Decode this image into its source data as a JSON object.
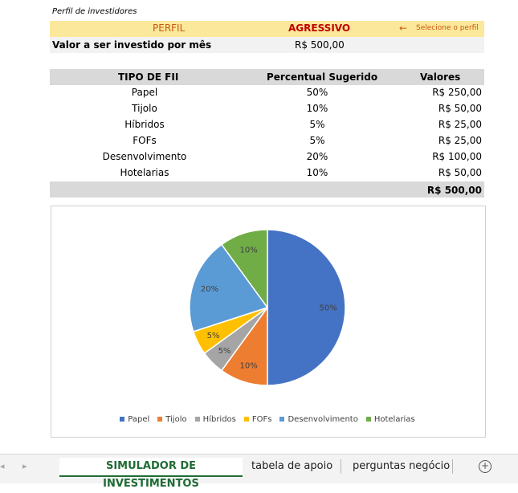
{
  "caption": "Perfil de investidores",
  "perfil": {
    "label": "PERFIL",
    "value": "AGRESSIVO",
    "hint_arrow": "←",
    "hint": "Selecione o perfil"
  },
  "valor": {
    "label": "Valor a ser investido por mês",
    "value": "R$ 500,00"
  },
  "table": {
    "headers": [
      "TIPO DE FII",
      "Percentual Sugerido",
      "Valores"
    ],
    "rows": [
      [
        "Papel",
        "50%",
        "R$ 250,00"
      ],
      [
        "Tijolo",
        "10%",
        "R$ 50,00"
      ],
      [
        "Híbridos",
        "5%",
        "R$ 25,00"
      ],
      [
        "FOFs",
        "5%",
        "R$ 25,00"
      ],
      [
        "Desenvolvimento",
        "20%",
        "R$ 100,00"
      ],
      [
        "Hotelarias",
        "10%",
        "R$ 50,00"
      ]
    ],
    "total": "R$ 500,00"
  },
  "chart_data": {
    "type": "pie",
    "categories": [
      "Papel",
      "Tijolo",
      "Híbridos",
      "FOFs",
      "Desenvolvimento",
      "Hotelarias"
    ],
    "values": [
      50,
      10,
      5,
      5,
      20,
      10
    ],
    "labels": [
      "50%",
      "10%",
      "5%",
      "5%",
      "20%",
      "10%"
    ],
    "colors": [
      "#4472c4",
      "#ed7d31",
      "#a5a5a5",
      "#ffc000",
      "#5b9bd5",
      "#70ad47"
    ],
    "legend": "bottom"
  },
  "tabs": {
    "nav_left": "◂",
    "nav_right": "▸",
    "items": [
      "SIMULADOR DE INVESTIMENTOS",
      "tabela de apoio",
      "perguntas negócio"
    ],
    "add": "+"
  }
}
